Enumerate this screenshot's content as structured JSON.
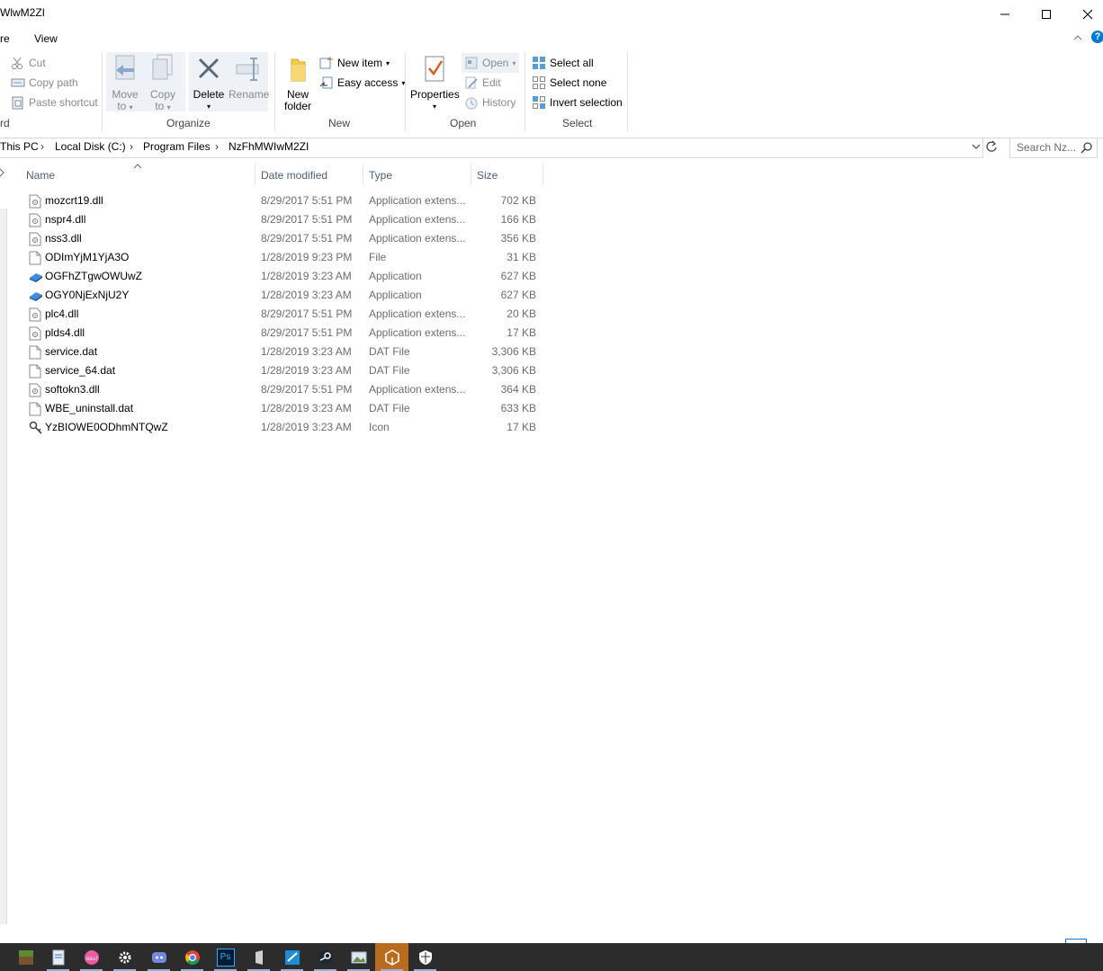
{
  "window": {
    "title": "WlwM2ZI",
    "controls": {
      "minimize": "minimize",
      "maximize": "maximize",
      "close": "close"
    }
  },
  "menu": {
    "tabs": [
      "re",
      "View"
    ]
  },
  "ribbon": {
    "clipboard": {
      "cut": "Cut",
      "copy_path": "Copy path",
      "paste_shortcut": "Paste shortcut",
      "label_fragment": "rd"
    },
    "organize": {
      "move_to": [
        "Move",
        "to"
      ],
      "copy_to": [
        "Copy",
        "to"
      ],
      "delete": "Delete",
      "rename": "Rename",
      "label": "Organize"
    },
    "new": {
      "new_folder": [
        "New",
        "folder"
      ],
      "new_item": "New item",
      "easy_access": "Easy access",
      "label": "New"
    },
    "open": {
      "properties": "Properties",
      "open": "Open",
      "edit": "Edit",
      "history": "History",
      "label": "Open"
    },
    "select": {
      "select_all": "Select all",
      "select_none": "Select none",
      "invert_selection": "Invert selection",
      "label": "Select"
    }
  },
  "address": {
    "crumbs": [
      "This PC",
      "Local Disk (C:)",
      "Program Files",
      "NzFhMWIwM2ZI"
    ],
    "search_placeholder": "Search Nz..."
  },
  "columns": {
    "name": "Name",
    "date": "Date modified",
    "type": "Type",
    "size": "Size"
  },
  "files": [
    {
      "name": "mozcrt19.dll",
      "date": "8/29/2017 5:51 PM",
      "type": "Application extens...",
      "size": "702 KB",
      "icon": "dll-icon"
    },
    {
      "name": "nspr4.dll",
      "date": "8/29/2017 5:51 PM",
      "type": "Application extens...",
      "size": "166 KB",
      "icon": "dll-icon"
    },
    {
      "name": "nss3.dll",
      "date": "8/29/2017 5:51 PM",
      "type": "Application extens...",
      "size": "356 KB",
      "icon": "dll-icon"
    },
    {
      "name": "ODImYjM1YjA3O",
      "date": "1/28/2019 9:23 PM",
      "type": "File",
      "size": "31 KB",
      "icon": "file-icon"
    },
    {
      "name": "OGFhZTgwOWUwZ",
      "date": "1/28/2019 3:23 AM",
      "type": "Application",
      "size": "627 KB",
      "icon": "app-icon"
    },
    {
      "name": "OGY0NjExNjU2Y",
      "date": "1/28/2019 3:23 AM",
      "type": "Application",
      "size": "627 KB",
      "icon": "app-icon"
    },
    {
      "name": "plc4.dll",
      "date": "8/29/2017 5:51 PM",
      "type": "Application extens...",
      "size": "20 KB",
      "icon": "dll-icon"
    },
    {
      "name": "plds4.dll",
      "date": "8/29/2017 5:51 PM",
      "type": "Application extens...",
      "size": "17 KB",
      "icon": "dll-icon"
    },
    {
      "name": "service.dat",
      "date": "1/28/2019 3:23 AM",
      "type": "DAT File",
      "size": "3,306 KB",
      "icon": "file-icon"
    },
    {
      "name": "service_64.dat",
      "date": "1/28/2019 3:23 AM",
      "type": "DAT File",
      "size": "3,306 KB",
      "icon": "file-icon"
    },
    {
      "name": "softokn3.dll",
      "date": "8/29/2017 5:51 PM",
      "type": "Application extens...",
      "size": "364 KB",
      "icon": "dll-icon"
    },
    {
      "name": "WBE_uninstall.dat",
      "date": "1/28/2019 3:23 AM",
      "type": "DAT File",
      "size": "633 KB",
      "icon": "file-icon"
    },
    {
      "name": "YzBIOWE0ODhmNTQwZ",
      "date": "1/28/2019 3:23 AM",
      "type": "Icon",
      "size": "17 KB",
      "icon": "key-icon"
    }
  ],
  "taskbar": {
    "apps": [
      "minecraft-icon",
      "notepad-icon",
      "osu-icon",
      "settings-icon",
      "discord-icon",
      "chrome-icon",
      "photoshop-icon",
      "audio-app-icon",
      "remote-app-icon",
      "steam-icon",
      "photos-icon",
      "unity-icon",
      "shield-icon"
    ],
    "ps_label": "Ps"
  },
  "colors": {
    "accent": "#0078d7",
    "taskbar": "#2c2c2c",
    "header_text": "#4c607a"
  }
}
